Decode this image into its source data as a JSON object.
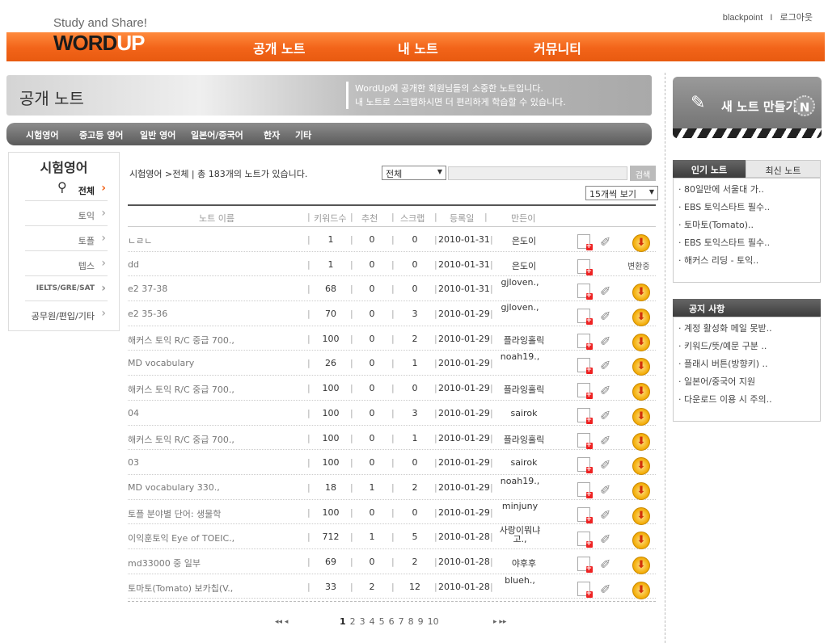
{
  "header": {
    "tagline": "Study and Share!",
    "user": "blackpoint",
    "separator": "I",
    "logout": "로그아웃",
    "logo_word": "WORD",
    "logo_up": "UP",
    "nav": [
      "공개 노트",
      "내 노트",
      "커뮤니티"
    ]
  },
  "title_bar": {
    "title": "공개 노트",
    "desc_line1": "WordUp에 공개한 회원님들의 소중한 노트입니다.",
    "desc_line2": "내 노트로 스크랩하시면 더 편리하게 학습할 수 있습니다."
  },
  "categories": [
    "시험영어",
    "중고등 영어",
    "일반 영어",
    "일본어/중국어",
    "한자",
    "기타"
  ],
  "left": {
    "heading": "시험영어",
    "items": [
      "전체",
      "토익",
      "토플",
      "텝스",
      "IELTS/GRE/SAT",
      "공무원/편입/기타"
    ]
  },
  "list": {
    "crumb": "시험영어 >전체 | 총 183개의 노트가 있습니다.",
    "filter": "전체",
    "search_btn": "검색",
    "per_page": "15개씩 보기",
    "headers": [
      "노트 이름",
      "키워드수",
      "추천",
      "스크랩",
      "등록일",
      "만든이"
    ],
    "converting": "변환중",
    "rows": [
      {
        "name": "ㄴㄹㄴ",
        "kw": "1",
        "rec": "0",
        "scrap": "0",
        "date": "2010-01-31",
        "by": "은도이"
      },
      {
        "name": "dd",
        "kw": "1",
        "rec": "0",
        "scrap": "0",
        "date": "2010-01-31",
        "by": "은도이"
      },
      {
        "name": "e2 37-38",
        "kw": "68",
        "rec": "0",
        "scrap": "0",
        "date": "2010-01-31",
        "by": "gjloven.,"
      },
      {
        "name": "e2 35-36",
        "kw": "70",
        "rec": "0",
        "scrap": "3",
        "date": "2010-01-29",
        "by": "gjloven.,"
      },
      {
        "name": "해커스 토익 R/C 중급 700.,",
        "kw": "100",
        "rec": "0",
        "scrap": "2",
        "date": "2010-01-29",
        "by": "플라잉홀릭"
      },
      {
        "name": "MD vocabulary",
        "kw": "26",
        "rec": "0",
        "scrap": "1",
        "date": "2010-01-29",
        "by": "noah19.,"
      },
      {
        "name": "해커스 토익 R/C 중급 700.,",
        "kw": "100",
        "rec": "0",
        "scrap": "0",
        "date": "2010-01-29",
        "by": "플라잉홀릭"
      },
      {
        "name": "04",
        "kw": "100",
        "rec": "0",
        "scrap": "3",
        "date": "2010-01-29",
        "by": "sairok"
      },
      {
        "name": "해커스 토익 R/C 중급 700.,",
        "kw": "100",
        "rec": "0",
        "scrap": "1",
        "date": "2010-01-29",
        "by": "플라잉홀릭"
      },
      {
        "name": "03",
        "kw": "100",
        "rec": "0",
        "scrap": "0",
        "date": "2010-01-29",
        "by": "sairok"
      },
      {
        "name": "MD vocabulary 330.,",
        "kw": "18",
        "rec": "1",
        "scrap": "2",
        "date": "2010-01-29",
        "by": "noah19.,"
      },
      {
        "name": "토플 분야별 단어: 생물학",
        "kw": "100",
        "rec": "0",
        "scrap": "0",
        "date": "2010-01-29",
        "by": "minjuny"
      },
      {
        "name": "이익훈토익 Eye of TOEIC.,",
        "kw": "712",
        "rec": "1",
        "scrap": "5",
        "date": "2010-01-28",
        "by": "사랑이뭐냐고.,"
      },
      {
        "name": "md33000 중 일부",
        "kw": "69",
        "rec": "0",
        "scrap": "2",
        "date": "2010-01-28",
        "by": "야후후"
      },
      {
        "name": "토마토(Tomato) 보카칩(V.,",
        "kw": "33",
        "rec": "2",
        "scrap": "12",
        "date": "2010-01-28",
        "by": "blueh.,"
      }
    ],
    "pager": {
      "prev": "◂◂ ◂",
      "pages": [
        "1",
        "2",
        "3",
        "4",
        "5",
        "6",
        "7",
        "8",
        "9",
        "10"
      ],
      "next": "▸ ▸▸"
    }
  },
  "right": {
    "new_note": "새 노트 만들기",
    "new_badge": "N",
    "tab_popular": "인기 노트",
    "tab_recent": "최신 노트",
    "popular": [
      "80일만에 서울대 가..",
      "EBS 토익스타트 필수..",
      "토마토(Tomato)..",
      "EBS 토익스타트 필수..",
      "해커스 리딩 - 토익.."
    ],
    "notice_head": "공지 사항",
    "notices": [
      "계정 활성화 메일 못받..",
      "키워드/뜻/예문 구분 ..",
      "플래시 버튼(방향키) ..",
      "일본어/중국어 지원",
      "다운로드 이용 시 주의.."
    ]
  },
  "colors": {
    "accent": "#f26419",
    "nav_dark": "#4a4a4a"
  }
}
